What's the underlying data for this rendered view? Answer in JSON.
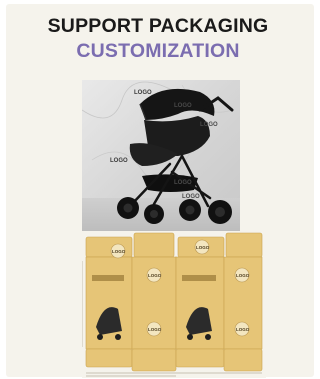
{
  "headline": {
    "line1": "SUPPORT PACKAGING",
    "line2": "CUSTOMIZATION"
  },
  "photo": {
    "logo_marks": [
      "LOGO",
      "LOGO",
      "LOGO",
      "LOGO",
      "LOGO",
      "LOGO"
    ]
  },
  "dieline": {
    "logo_marks": [
      "LOGO",
      "LOGO",
      "LOGO",
      "LOGO",
      "LOGO",
      "LOGO"
    ]
  },
  "colors": {
    "headline_dark": "#1a1a1a",
    "headline_accent": "#7b6db0",
    "panel_background": "#f5f3ec",
    "carton_kraft": "#e6c577",
    "stroller_black": "#111111"
  },
  "icons": [
    "stroller-illustration",
    "carton-dieline-illustration"
  ]
}
